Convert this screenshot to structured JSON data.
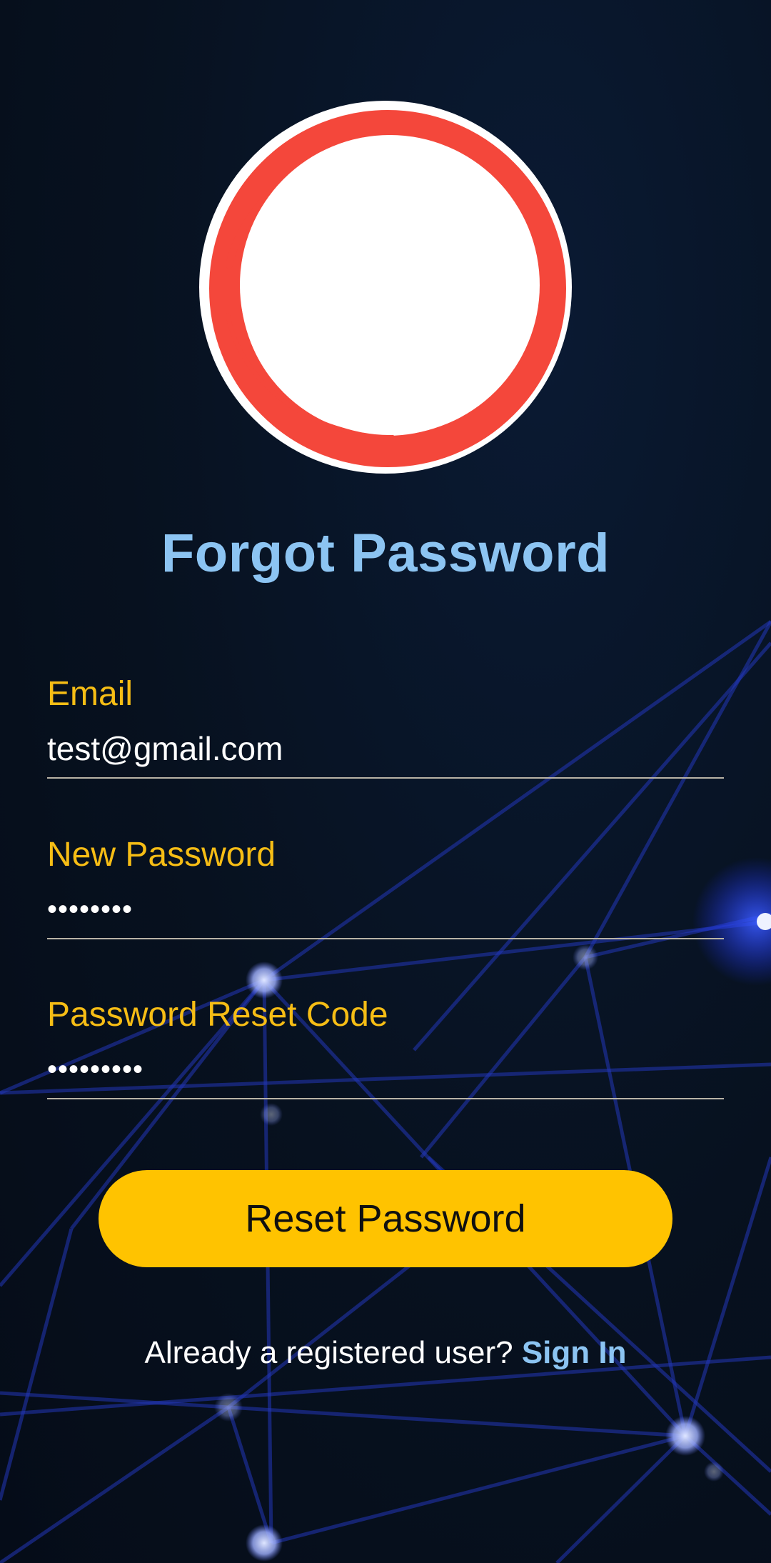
{
  "screen": {
    "title": "Forgot Password",
    "logo_icon": "red-brush-circle-logo"
  },
  "fields": {
    "email": {
      "label": "Email",
      "value": "test@gmail.com"
    },
    "new_password": {
      "label": "New Password",
      "value": "••••••••"
    },
    "reset_code": {
      "label": "Password Reset Code",
      "value": "•••••••••"
    }
  },
  "actions": {
    "reset_label": "Reset Password",
    "signin_prompt": "Already a registered user?",
    "signin_link": "Sign In"
  },
  "colors": {
    "accent_label": "#f6bd15",
    "title": "#8cc4f2",
    "button": "#ffc300",
    "background": "#07111f",
    "logo_ring": "#f4473b"
  }
}
